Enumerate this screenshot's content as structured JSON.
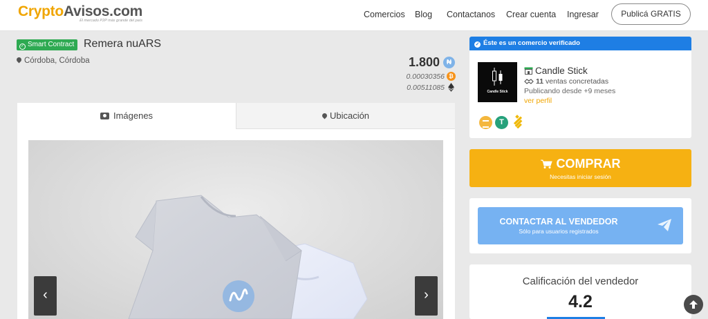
{
  "navbar": {
    "logo_crypto": "Crypto",
    "logo_avisos": "Avisos.com",
    "logo_tagline": "El mercado P2P más grande del país",
    "links": [
      {
        "label": "Comercios"
      },
      {
        "label": "Blog"
      },
      {
        "label": "Contactanos"
      },
      {
        "label": "Crear cuenta"
      },
      {
        "label": "Ingresar"
      }
    ],
    "cta": "Publicá GRATIS"
  },
  "product": {
    "badge": "Smart Contract",
    "title": "Remera nuARS",
    "location": "Córdoba, Córdoba",
    "price": "1.800",
    "price_currency_icon": "nuars-icon",
    "price_btc": "0.00030356",
    "price_eth": "0.00511085"
  },
  "tabs": [
    {
      "label": "Imágenes",
      "icon": "camera-icon",
      "active": true
    },
    {
      "label": "Ubicación",
      "icon": "map-marker-icon",
      "active": false
    }
  ],
  "gallery": {
    "prev_label": "‹",
    "next_label": "›"
  },
  "seller": {
    "verified_label": "Éste es un comercio verificado",
    "logo_text": "Candle Stick",
    "name": "Candle Stick",
    "sales_count": "11",
    "sales_label": "ventas concretadas",
    "since": "Publicando desde +9 meses",
    "profile_link": "ver perfil",
    "accepted_coins": [
      "dai-icon",
      "tether-icon",
      "binance-usd-icon"
    ]
  },
  "buy": {
    "label": "COMPRAR",
    "sub": "Necesitas iniciar sesión"
  },
  "contact": {
    "label": "CONTACTAR AL VENDEDOR",
    "sub": "Sólo para usuarios registrados"
  },
  "rating": {
    "title": "Calificación del vendedor",
    "value": "4.2"
  },
  "colors": {
    "brand": "#f0a500",
    "verified_blue": "#1e7ee4",
    "buy_yellow": "#f6b112",
    "contact_blue": "#76b2f2",
    "smart_contract_green": "#2eaa52"
  }
}
